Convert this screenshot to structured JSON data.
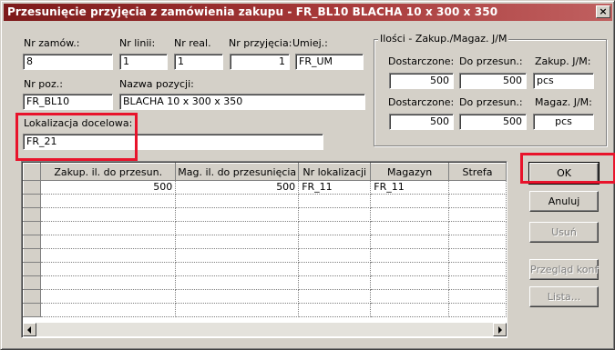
{
  "window": {
    "title": "Przesunięcie przyjęcia z zamówienia zakupu - FR_BL10 BLACHA 10 x 300 x 350",
    "close_glyph": "×"
  },
  "header": {
    "order_no": {
      "label": "Nr zamów.:",
      "value": "8"
    },
    "line_no": {
      "label": "Nr linii:",
      "value": "1"
    },
    "real_no": {
      "label": "Nr real.",
      "value": "1"
    },
    "receipt_no": {
      "label": "Nr przyjęcia:",
      "value": "1"
    },
    "location": {
      "label": "Umiej.:",
      "value": "FR_UM"
    },
    "item_no": {
      "label": "Nr poz.:",
      "value": "FR_BL10"
    },
    "item_name": {
      "label": "Nazwa pozycji:",
      "value": "BLACHA 10 x 300 x 350"
    },
    "target_location": {
      "label": "Lokalizacja docelowa:",
      "value": "FR_21"
    }
  },
  "quantities": {
    "title": "Ilości - Zakup./Magaz. J/M",
    "delivered_label": "Dostarczone:",
    "to_move_label": "Do przesun.:",
    "purchase_um_label": "Zakup. J/M:",
    "store_um_label": "Magaz. J/M:",
    "purchase": {
      "delivered": "500",
      "to_move": "500",
      "um": "pcs"
    },
    "store": {
      "delivered": "500",
      "to_move": "500",
      "um": "pcs"
    }
  },
  "grid": {
    "columns": [
      "Zakup. il. do przesun.",
      "Mag. il. do przesunięcia",
      "Nr lokalizacji",
      "Magazyn",
      "Strefa"
    ],
    "rows": [
      [
        "500",
        "500",
        "FR_11",
        "FR_11",
        ""
      ],
      [
        "",
        "",
        "",
        "",
        ""
      ],
      [
        "",
        "",
        "",
        "",
        ""
      ],
      [
        "",
        "",
        "",
        "",
        ""
      ],
      [
        "",
        "",
        "",
        "",
        ""
      ],
      [
        "",
        "",
        "",
        "",
        ""
      ],
      [
        "",
        "",
        "",
        "",
        ""
      ],
      [
        "",
        "",
        "",
        "",
        ""
      ],
      [
        "",
        "",
        "",
        "",
        ""
      ],
      [
        "",
        "",
        "",
        "",
        ""
      ]
    ]
  },
  "buttons": {
    "ok": "OK",
    "cancel": "Anuluj",
    "delete": "Usuń",
    "config": "Przegląd konf",
    "list": "Lista..."
  },
  "colors": {
    "highlight": "#e8132b",
    "title_bar": "#7d1a1a"
  }
}
